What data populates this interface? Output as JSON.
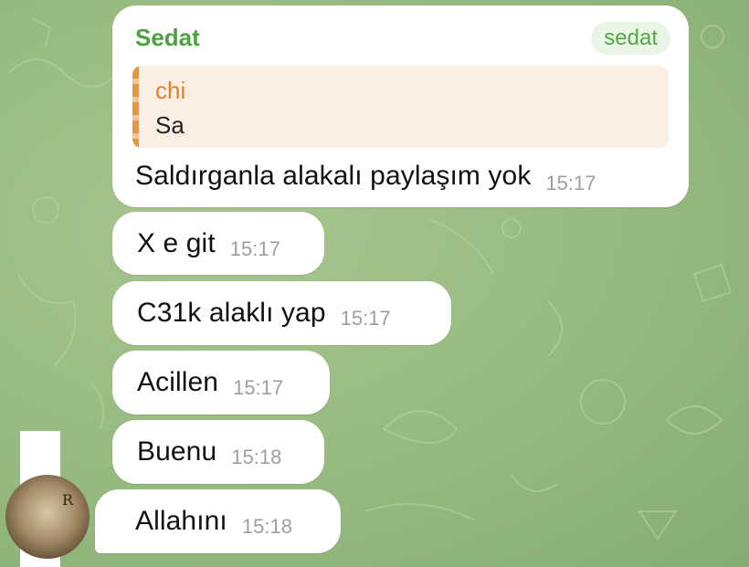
{
  "first_message": {
    "sender": "Sedat",
    "tag": "sedat",
    "reply": {
      "name": "chi",
      "text": "Sa"
    },
    "text": "Saldırganla alakalı paylaşım yok",
    "time": "15:17"
  },
  "messages": [
    {
      "text": "X e git",
      "time": "15:17"
    },
    {
      "text": "C31k alaklı yap",
      "time": "15:17"
    },
    {
      "text": "Acillen",
      "time": "15:17"
    },
    {
      "text": "Buenu",
      "time": "15:18"
    },
    {
      "text": "Allahını",
      "time": "15:18"
    }
  ],
  "avatar_text": "R",
  "colors": {
    "sender": "#4aa33d",
    "reply_accent": "#e9953c",
    "time": "#9a9fa4",
    "background": "#9bbd84"
  }
}
